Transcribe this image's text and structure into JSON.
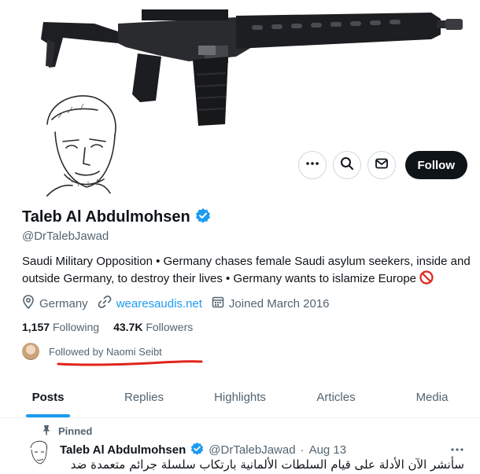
{
  "profile": {
    "name": "Taleb Al Abdulmohsen",
    "handle": "@DrTalebJawad",
    "bio": "Saudi Military Opposition • Germany chases female Saudi asylum seekers, inside and outside Germany, to destroy their lives • Germany wants to islamize Europe",
    "location": "Germany",
    "website": "wearesaudis.net",
    "joined": "Joined March 2016",
    "following_count": "1,157",
    "following_label": "Following",
    "followers_count": "43.7K",
    "followers_label": "Followers",
    "followed_by": "Followed by Naomi Seibt"
  },
  "actions": {
    "follow_label": "Follow",
    "more_icon": "more-icon",
    "search_icon": "search-icon",
    "message_icon": "message-icon"
  },
  "tabs": [
    {
      "label": "Posts",
      "active": true
    },
    {
      "label": "Replies"
    },
    {
      "label": "Highlights"
    },
    {
      "label": "Articles"
    },
    {
      "label": "Media"
    }
  ],
  "pinned_tweet": {
    "pinned_label": "Pinned",
    "author_name": "Taleb Al Abdulmohsen",
    "author_handle": "@DrTalebJawad",
    "separator": "·",
    "date": "Aug 13",
    "text": "سأنشر الآن الأدلة على قيام السلطات الألمانية بارتكاب سلسلة جرائم متعمدة ضد"
  },
  "colors": {
    "accent": "#1d9bf0",
    "verified": "#1d9bf0",
    "annotation_red": "#e0241b",
    "text_primary": "#0f1419",
    "text_secondary": "#536471"
  }
}
